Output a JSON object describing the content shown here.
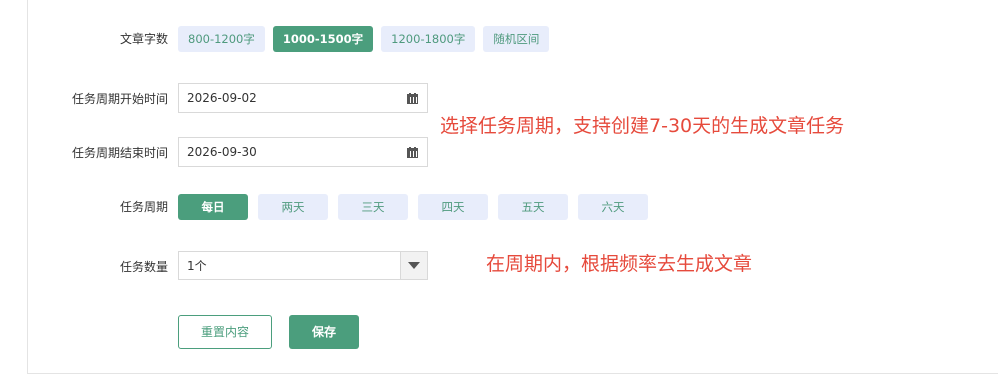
{
  "form": {
    "word_count": {
      "label": "文章字数",
      "options": [
        "800-1200字",
        "1000-1500字",
        "1200-1800字",
        "随机区间"
      ],
      "selected": "1000-1500字"
    },
    "start_date": {
      "label": "任务周期开始时间",
      "value": "2026-09-02"
    },
    "end_date": {
      "label": "任务周期结束时间",
      "value": "2026-09-30"
    },
    "period": {
      "label": "任务周期",
      "options": [
        "每日",
        "两天",
        "三天",
        "四天",
        "五天",
        "六天"
      ],
      "selected": "每日"
    },
    "quantity": {
      "label": "任务数量",
      "value": "1个"
    },
    "reset_label": "重置内容",
    "save_label": "保存"
  },
  "annotations": {
    "date_note": "选择任务周期，支持创建7-30天的生成文章任务",
    "quantity_note": "在周期内，根据频率去生成文章"
  },
  "colors": {
    "accent": "#4b9e7d",
    "pill_bg": "#e8edfb",
    "annotation": "#e64a3c"
  }
}
